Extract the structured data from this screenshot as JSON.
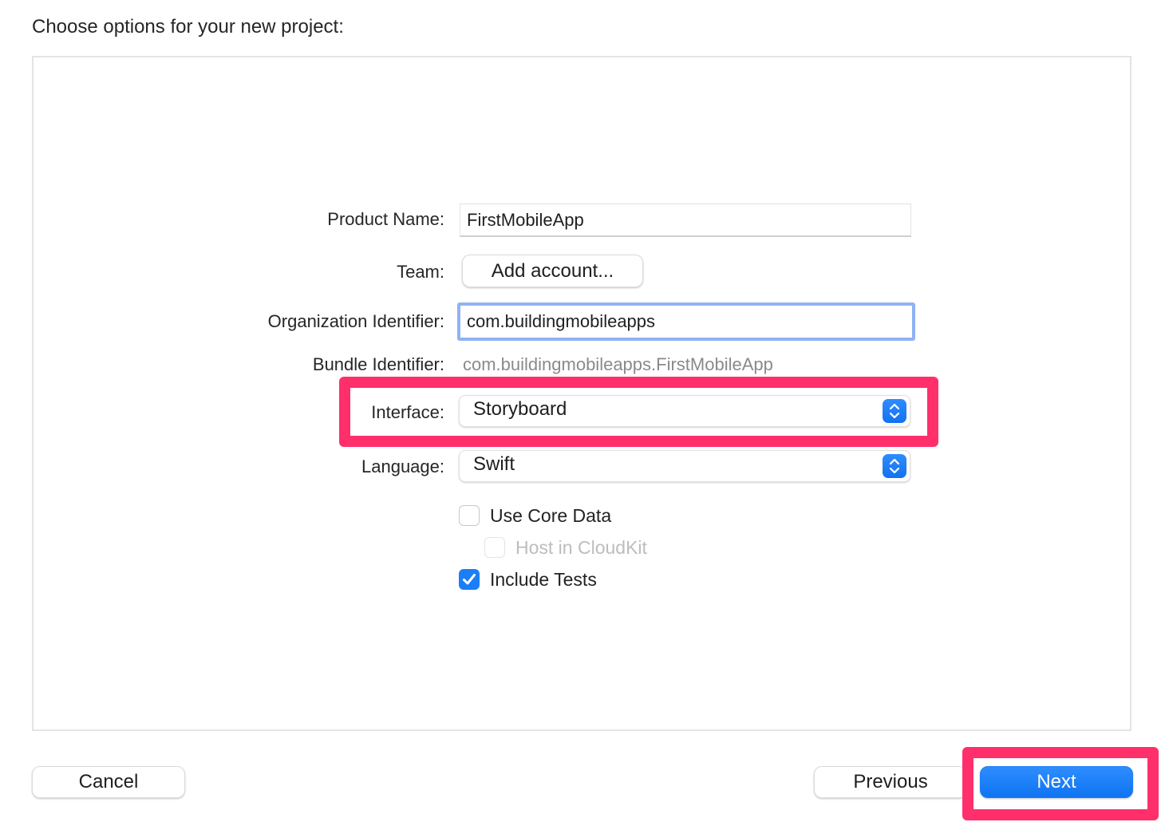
{
  "heading": "Choose options for your new project:",
  "form": {
    "product_name": {
      "label": "Product Name:",
      "value": "FirstMobileApp"
    },
    "team": {
      "label": "Team:",
      "button_label": "Add account..."
    },
    "organization_identifier": {
      "label": "Organization Identifier:",
      "value": "com.buildingmobileapps"
    },
    "bundle_identifier": {
      "label": "Bundle Identifier:",
      "value": "com.buildingmobileapps.FirstMobileApp"
    },
    "interface": {
      "label": "Interface:",
      "selected": "Storyboard",
      "highlighted": true
    },
    "language": {
      "label": "Language:",
      "selected": "Swift"
    },
    "checkboxes": [
      {
        "label": "Use Core Data",
        "checked": false,
        "enabled": true
      },
      {
        "label": "Host in CloudKit",
        "checked": false,
        "enabled": false
      },
      {
        "label": "Include Tests",
        "checked": true,
        "enabled": true
      }
    ]
  },
  "footer": {
    "cancel_label": "Cancel",
    "previous_label": "Previous",
    "next_label": "Next",
    "next_highlighted": true
  },
  "colors": {
    "accent": "#1a7ef7",
    "highlight": "#ff2f6b",
    "focus_ring": "#8fb2f5"
  }
}
